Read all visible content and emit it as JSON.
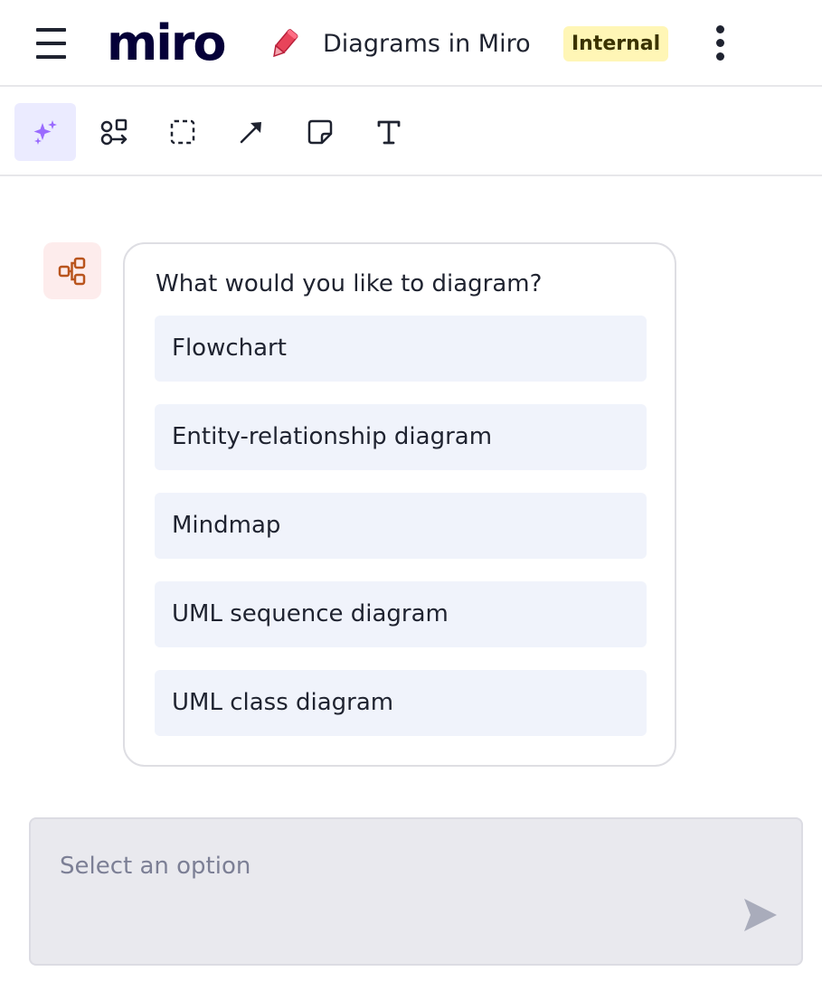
{
  "header": {
    "logo_text": "miro",
    "board_title": "Diagrams in Miro",
    "badge": "Internal",
    "icons": [
      "menu-icon",
      "pencil-icon",
      "more-vertical-icon"
    ],
    "colors": {
      "pencil": "#e8445a",
      "badge_bg": "#fff6b6",
      "logo": "#050038"
    }
  },
  "toolbar": {
    "tools": [
      {
        "name": "ai-sparkles",
        "active": true
      },
      {
        "name": "diagram-shapes",
        "active": false
      },
      {
        "name": "frame-select",
        "active": false
      },
      {
        "name": "connector-arrow",
        "active": false
      },
      {
        "name": "sticky-note",
        "active": false
      },
      {
        "name": "text",
        "active": false
      }
    ],
    "active_color": "#ebebff",
    "sparkle_color": "#9a6bff"
  },
  "chat": {
    "avatar_icon": "diagram-icon",
    "avatar_color": "#b9541d",
    "question": "What would you like to diagram?",
    "options": [
      "Flowchart",
      "Entity-relationship diagram",
      "Mindmap",
      "UML sequence diagram",
      "UML class diagram"
    ]
  },
  "composer": {
    "placeholder": "Select an option",
    "value": "",
    "send_icon": "send-icon"
  }
}
